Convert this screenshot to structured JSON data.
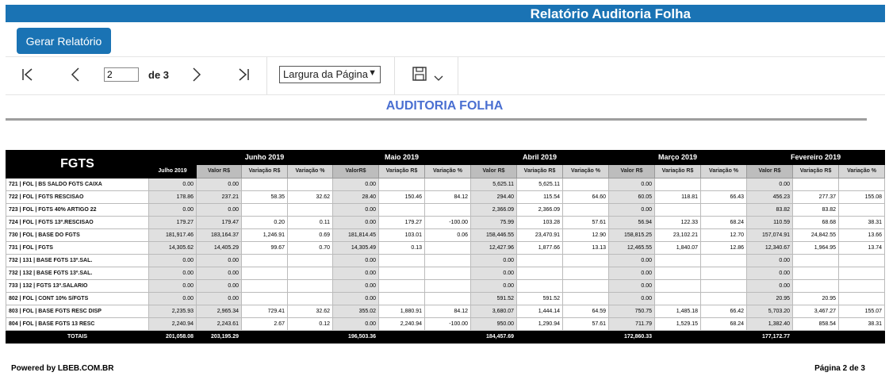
{
  "app": {
    "title": "Relatório Auditoria Folha",
    "generate_label": "Gerar Relatório"
  },
  "toolbar": {
    "current_page": "2",
    "of_label": "de 3",
    "zoom_value": "Largura da Página"
  },
  "report": {
    "heading": "AUDITORIA FOLHA",
    "section_title": "FGTS",
    "months": [
      "Junho 2019",
      "Maio 2019",
      "Abril 2019",
      "Março 2019",
      "Fevereiro 2019"
    ],
    "base_month": "Julho 2019",
    "subheaders": [
      [
        "Valor R$",
        "Variação R$",
        "Variação %"
      ],
      [
        "ValorR$",
        "Variação R$",
        "Variação %"
      ],
      [
        "Valor R$",
        "Variação R$",
        "Variação %"
      ],
      [
        "Valor R$",
        "Variação R$",
        "Variação %"
      ],
      [
        "Valor R$",
        "Variação R$",
        "Variação %"
      ]
    ],
    "rows": [
      {
        "label": "721 | FOL | BS SALDO FGTS CAIXA",
        "cells": [
          "0.00",
          "0.00",
          "",
          "",
          "0.00",
          "",
          "",
          "5,625.11",
          "5,625.11",
          "",
          "0.00",
          "",
          "",
          "0.00",
          "",
          ""
        ]
      },
      {
        "label": "722 | FOL | FGTS RESCISAO",
        "cells": [
          "178.86",
          "237.21",
          "58.35",
          "32.62",
          "28.40",
          "150.46",
          "84.12",
          "294.40",
          "115.54",
          "64.60",
          "60.05",
          "118.81",
          "66.43",
          "456.23",
          "277.37",
          "155.08"
        ]
      },
      {
        "label": "723 | FOL | FGTS 40% ARTIGO 22",
        "cells": [
          "0.00",
          "0.00",
          "",
          "",
          "0.00",
          "",
          "",
          "2,366.09",
          "2,366.09",
          "",
          "0.00",
          "",
          "",
          "83.82",
          "83.82",
          ""
        ]
      },
      {
        "label": "724 | FOL | FGTS 13º.RESCISAO",
        "cells": [
          "179.27",
          "179.47",
          "0.20",
          "0.11",
          "0.00",
          "179.27",
          "-100.00",
          "75.99",
          "103.28",
          "57.61",
          "56.94",
          "122.33",
          "68.24",
          "110.59",
          "68.68",
          "38.31"
        ]
      },
      {
        "label": "730 | FOL | BASE DO FGTS",
        "cells": [
          "181,917.46",
          "183,164.37",
          "1,246.91",
          "0.69",
          "181,814.45",
          "103.01",
          "0.06",
          "158,446.55",
          "23,470.91",
          "12.90",
          "158,815.25",
          "23,102.21",
          "12.70",
          "157,074.91",
          "24,842.55",
          "13.66"
        ]
      },
      {
        "label": "731 | FOL | FGTS",
        "cells": [
          "14,305.62",
          "14,405.29",
          "99.67",
          "0.70",
          "14,305.49",
          "0.13",
          "",
          "12,427.96",
          "1,877.66",
          "13.13",
          "12,465.55",
          "1,840.07",
          "12.86",
          "12,340.67",
          "1,964.95",
          "13.74"
        ]
      },
      {
        "label": "732 | 131 | BASE FGTS 13º.SAL.",
        "cells": [
          "0.00",
          "0.00",
          "",
          "",
          "0.00",
          "",
          "",
          "0.00",
          "",
          "",
          "0.00",
          "",
          "",
          "0.00",
          "",
          ""
        ]
      },
      {
        "label": "732 | 132 | BASE FGTS 13º.SAL.",
        "cells": [
          "0.00",
          "0.00",
          "",
          "",
          "0.00",
          "",
          "",
          "0.00",
          "",
          "",
          "0.00",
          "",
          "",
          "0.00",
          "",
          ""
        ]
      },
      {
        "label": "733 | 132 | FGTS 13º.SALARIO",
        "cells": [
          "0.00",
          "0.00",
          "",
          "",
          "0.00",
          "",
          "",
          "0.00",
          "",
          "",
          "0.00",
          "",
          "",
          "0.00",
          "",
          ""
        ]
      },
      {
        "label": "802 | FOL | CONT 10% S/FGTS",
        "cells": [
          "0.00",
          "0.00",
          "",
          "",
          "0.00",
          "",
          "",
          "591.52",
          "591.52",
          "",
          "0.00",
          "",
          "",
          "20.95",
          "20.95",
          ""
        ]
      },
      {
        "label": "803 | FOL | BASE FGTS RESC DISP",
        "cells": [
          "2,235.93",
          "2,965.34",
          "729.41",
          "32.62",
          "355.02",
          "1,880.91",
          "84.12",
          "3,680.07",
          "1,444.14",
          "64.59",
          "750.75",
          "1,485.18",
          "66.42",
          "5,703.20",
          "3,467.27",
          "155.07"
        ]
      },
      {
        "label": "804 | FOL | BASE FGTS 13 RESC",
        "cells": [
          "2,240.94",
          "2,243.61",
          "2.67",
          "0.12",
          "0.00",
          "2,240.94",
          "-100.00",
          "950.00",
          "1,290.94",
          "57.61",
          "711.79",
          "1,529.15",
          "68.24",
          "1,382.40",
          "858.54",
          "38.31"
        ]
      }
    ],
    "totals": {
      "label": "TOTAIS",
      "cells": [
        "201,058.08",
        "203,195.29",
        "",
        "",
        "196,503.36",
        "",
        "",
        "184,457.69",
        "",
        "",
        "172,860.33",
        "",
        "",
        "177,172.77",
        "",
        ""
      ]
    }
  },
  "footer": {
    "powered": "Powered by LBEB.COM.BR",
    "page_info": "Página 2 de 3"
  }
}
